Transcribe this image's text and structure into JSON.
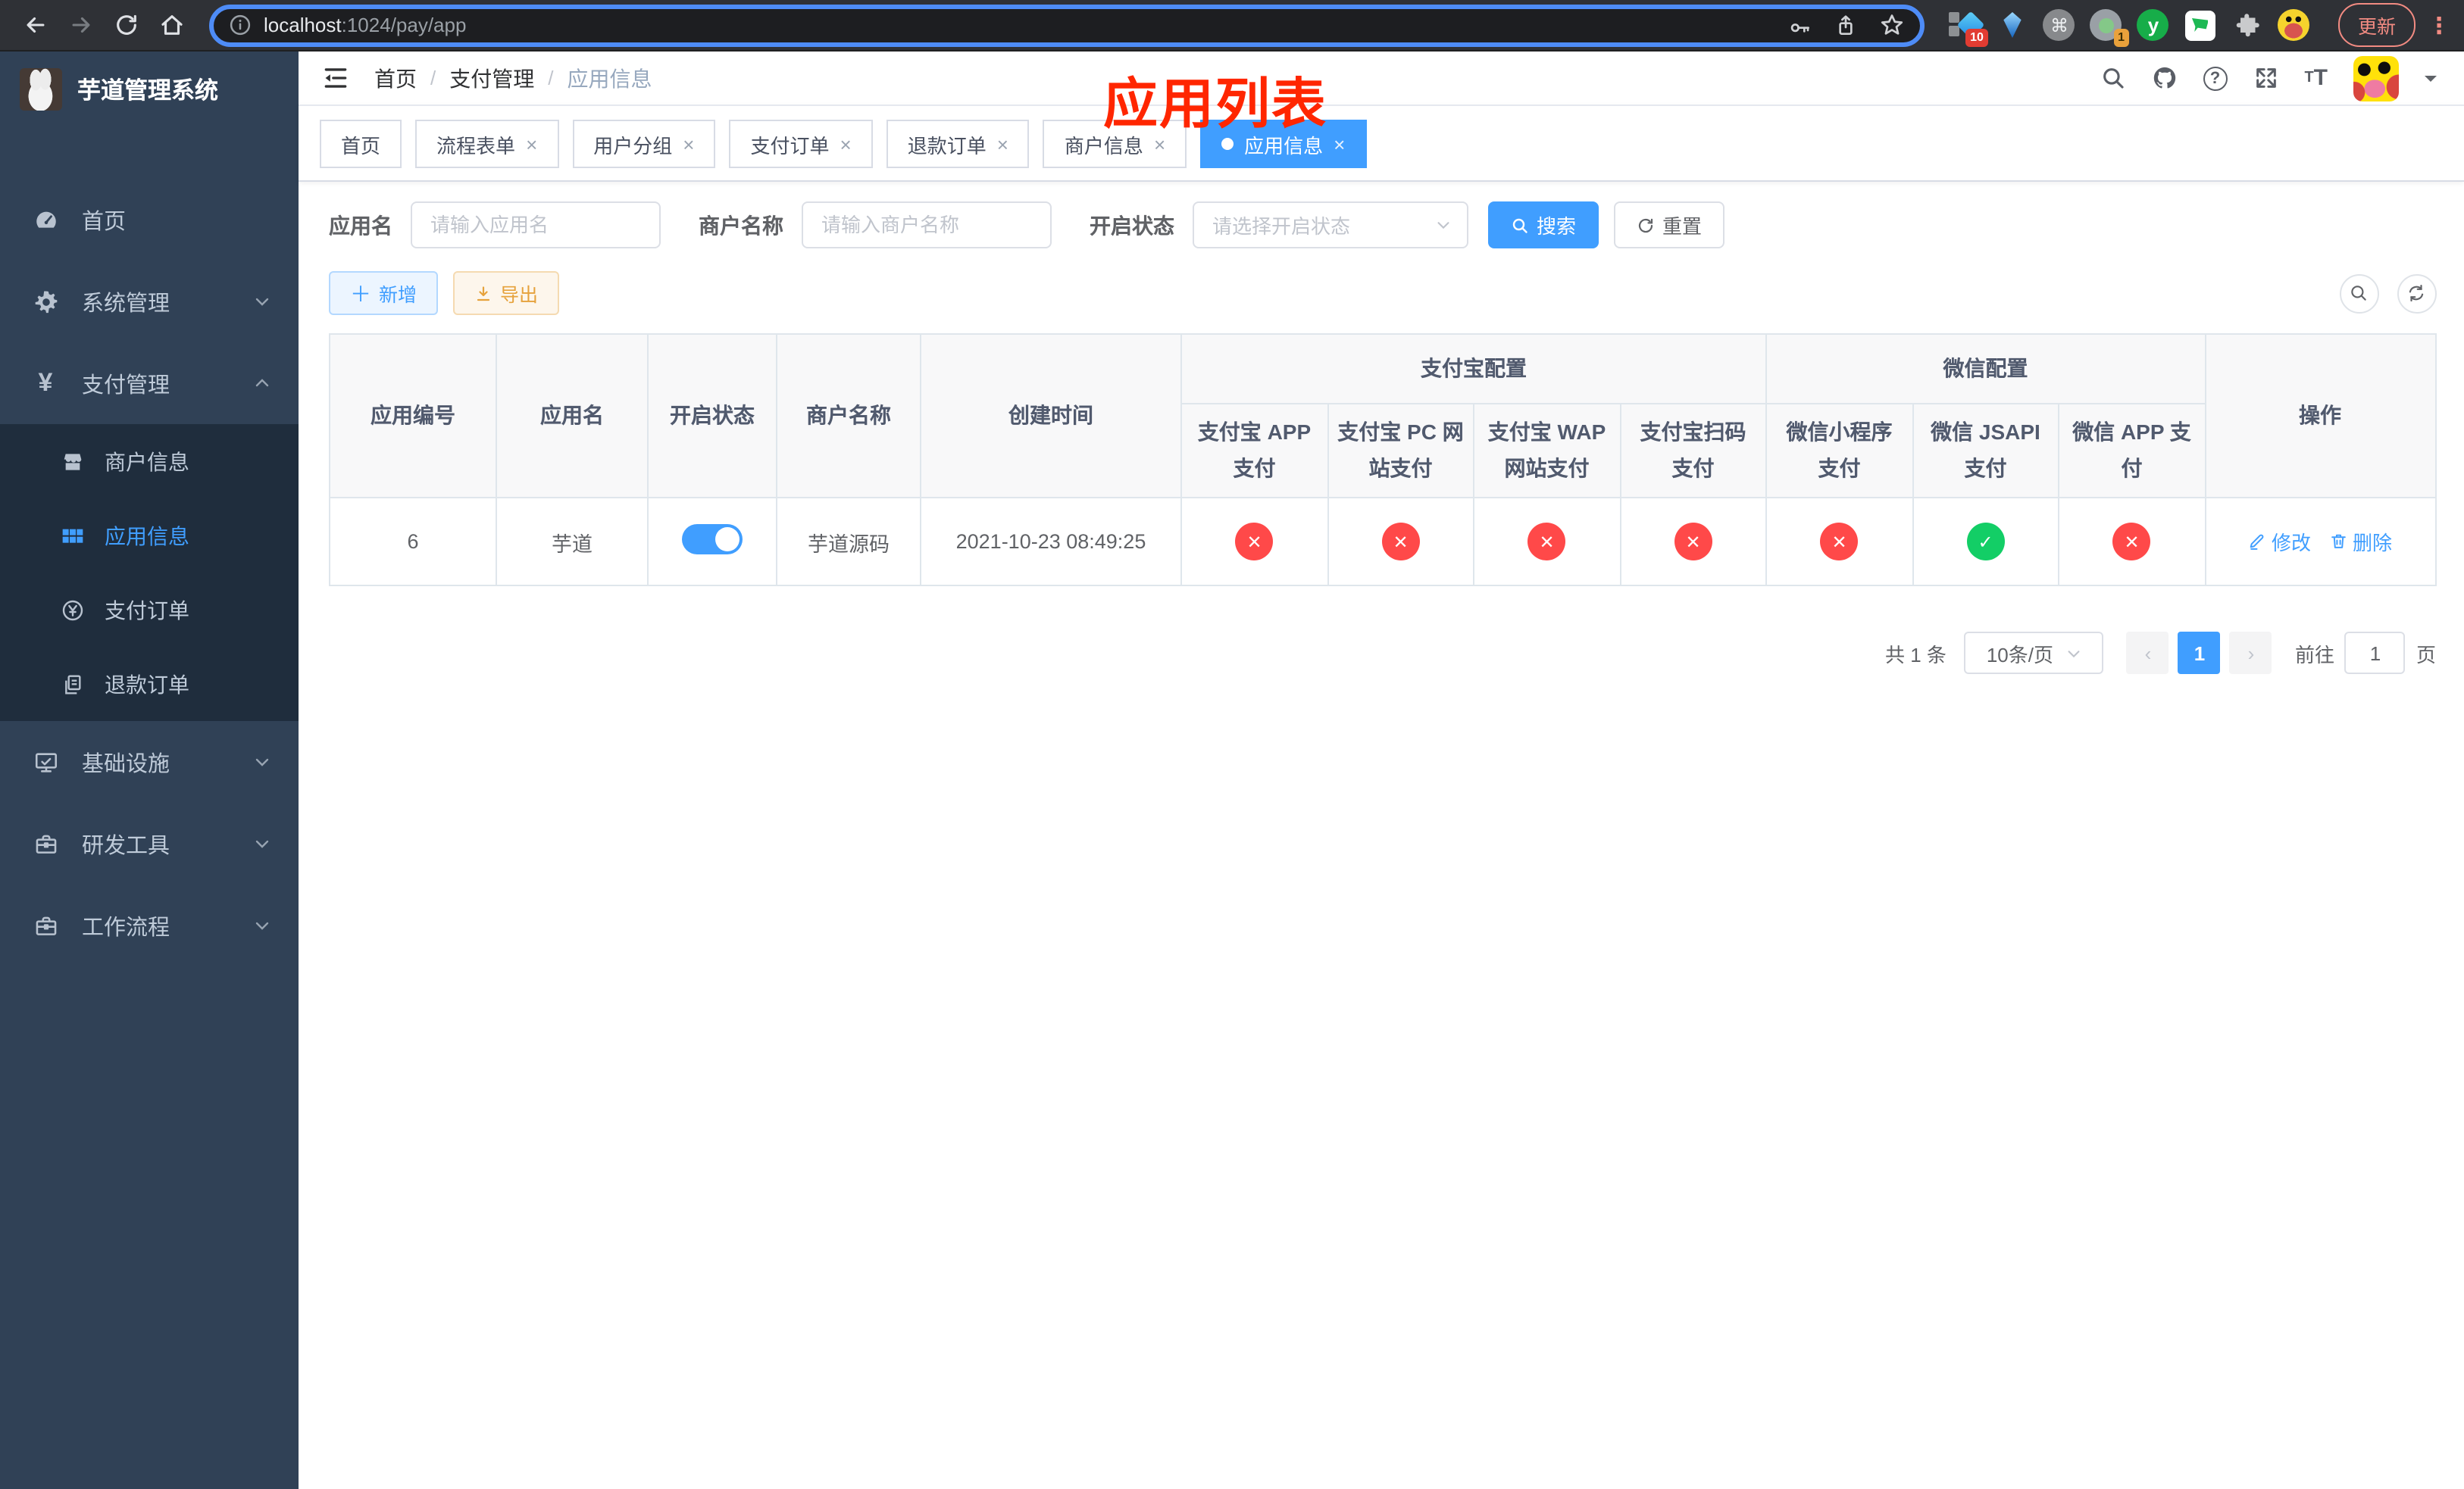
{
  "browser": {
    "url_host": "localhost",
    "url_rest": ":1024/pay/app",
    "update_label": "更新",
    "ext_badge_blue_diamond": "10",
    "ext_badge_gray_dot": "1",
    "ext_letter_y": "y"
  },
  "annotation": {
    "text": "应用列表"
  },
  "sidebar": {
    "logo_title": "芋道管理系统",
    "menu": [
      {
        "label": "首页"
      },
      {
        "label": "系统管理"
      },
      {
        "label": "支付管理"
      }
    ],
    "submenu": [
      {
        "label": "商户信息"
      },
      {
        "label": "应用信息"
      },
      {
        "label": "支付订单"
      },
      {
        "label": "退款订单"
      }
    ],
    "menu_bottom": [
      {
        "label": "基础设施"
      },
      {
        "label": "研发工具"
      },
      {
        "label": "工作流程"
      }
    ]
  },
  "header": {
    "breadcrumb": [
      "首页",
      "支付管理",
      "应用信息"
    ]
  },
  "tabs": [
    {
      "label": "首页",
      "closable": false,
      "active": false
    },
    {
      "label": "流程表单",
      "closable": true,
      "active": false
    },
    {
      "label": "用户分组",
      "closable": true,
      "active": false
    },
    {
      "label": "支付订单",
      "closable": true,
      "active": false
    },
    {
      "label": "退款订单",
      "closable": true,
      "active": false
    },
    {
      "label": "商户信息",
      "closable": true,
      "active": false
    },
    {
      "label": "应用信息",
      "closable": true,
      "active": true
    }
  ],
  "filters": {
    "app_name_label": "应用名",
    "app_name_placeholder": "请输入应用名",
    "merchant_label": "商户名称",
    "merchant_placeholder": "请输入商户名称",
    "status_label": "开启状态",
    "status_placeholder": "请选择开启状态",
    "search_label": "搜索",
    "reset_label": "重置"
  },
  "toolbar": {
    "add_label": "新增",
    "export_label": "导出"
  },
  "table": {
    "main_columns": [
      "应用编号",
      "应用名",
      "开启状态",
      "商户名称",
      "创建时间"
    ],
    "groups": {
      "alipay": "支付宝配置",
      "wechat": "微信配置"
    },
    "pay_columns": [
      "支付宝 APP 支付",
      "支付宝 PC 网站支付",
      "支付宝 WAP 网站支付",
      "支付宝扫码支付",
      "微信小程序支付",
      "微信 JSAPI 支付",
      "微信 APP 支付"
    ],
    "action_column": "操作",
    "rows": [
      {
        "id": "6",
        "name": "芋道",
        "enabled": true,
        "merchant": "芋道源码",
        "created": "2021-10-23 08:49:25",
        "statuses": [
          false,
          false,
          false,
          false,
          false,
          true,
          false
        ],
        "edit_label": "修改",
        "delete_label": "删除"
      }
    ]
  },
  "pagination": {
    "total_label": "共 1 条",
    "page_size": "10条/页",
    "current_page": "1",
    "goto_label": "前往",
    "goto_value": "1",
    "page_suffix": "页"
  },
  "colors": {
    "accent": "#409eff",
    "success": "#13ce66",
    "danger": "#ff4949",
    "warning": "#e6a23c",
    "sidebar-bg": "#304156",
    "submenu-bg": "#1f2d3d",
    "sidebar-text": "#bfcbd9",
    "annotation": "#ff2600"
  }
}
